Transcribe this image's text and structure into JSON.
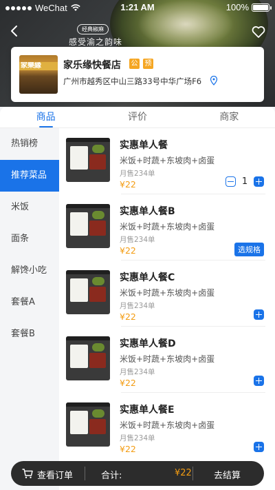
{
  "status_bar": {
    "carrier": "WeChat",
    "time": "1:21 AM",
    "battery": "100%"
  },
  "hero": {
    "badge": "经典椒麻",
    "slogan": "感受渝之韵味"
  },
  "shop": {
    "photo_sign": "家樂縁",
    "name": "家乐缘快餐店",
    "tags": [
      "公",
      "预"
    ],
    "address": "广州市越秀区中山三路33号中华广场F6"
  },
  "tabs": [
    {
      "label": "商品",
      "active": true
    },
    {
      "label": "评价",
      "active": false
    },
    {
      "label": "商家",
      "active": false
    }
  ],
  "categories": [
    {
      "label": "热销榜",
      "active": false
    },
    {
      "label": "推荐菜品",
      "active": true
    },
    {
      "label": "米饭",
      "active": false
    },
    {
      "label": "面条",
      "active": false
    },
    {
      "label": "解馋小吃",
      "active": false
    },
    {
      "label": "套餐A",
      "active": false
    },
    {
      "label": "套餐B",
      "active": false
    }
  ],
  "items": [
    {
      "name": "实惠单人餐",
      "desc": "米饭+时蔬+东坡肉+卤蛋",
      "sold": "月售234单",
      "price": "¥22",
      "control": "stepper",
      "qty": "1"
    },
    {
      "name": "实惠单人餐B",
      "desc": "米饭+时蔬+东坡肉+卤蛋",
      "sold": "月售234单",
      "price": "¥22",
      "control": "spec",
      "spec_label": "选规格"
    },
    {
      "name": "实惠单人餐C",
      "desc": "米饭+时蔬+东坡肉+卤蛋",
      "sold": "月售234单",
      "price": "¥22",
      "control": "add"
    },
    {
      "name": "实惠单人餐D",
      "desc": "米饭+时蔬+东坡肉+卤蛋",
      "sold": "月售234单",
      "price": "¥22",
      "control": "add"
    },
    {
      "name": "实惠单人餐E",
      "desc": "米饭+时蔬+东坡肉+卤蛋",
      "sold": "月售234单",
      "price": "¥22",
      "control": "add"
    }
  ],
  "cart": {
    "view_label": "查看订单",
    "total_label": "合计:",
    "total_amount": "¥22",
    "checkout_label": "去结算"
  },
  "colors": {
    "accent": "#1a73e8",
    "price": "#f39c12",
    "tag": "#f5a623",
    "cart_bar": "#2c2c2c"
  },
  "icons": [
    "back-icon",
    "heart-icon",
    "location-icon",
    "cart-icon",
    "wifi-icon",
    "battery-icon"
  ]
}
